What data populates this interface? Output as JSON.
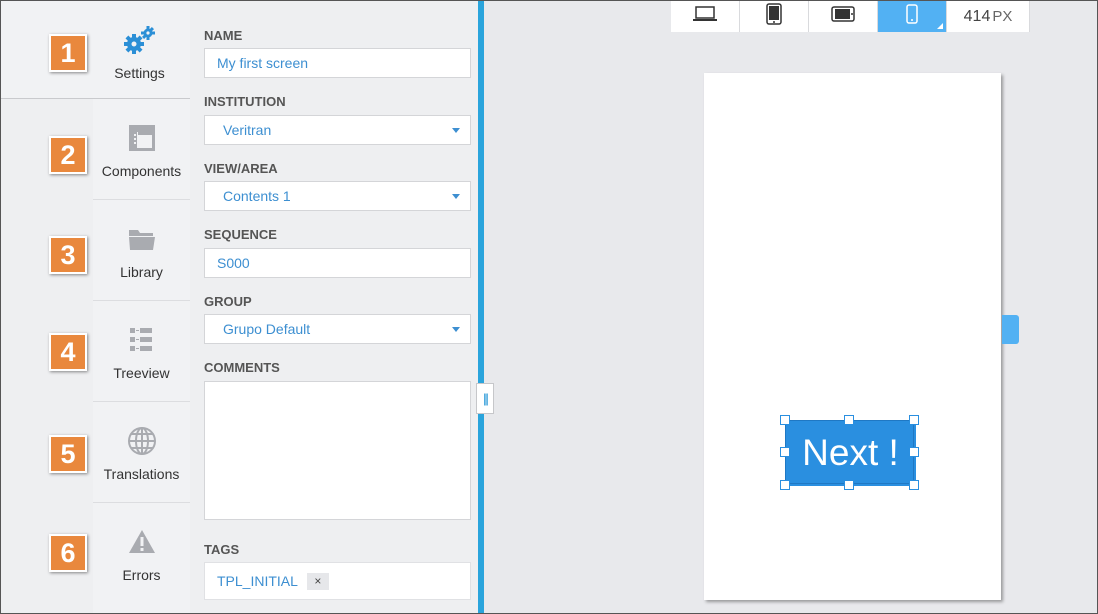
{
  "nav": {
    "items": [
      {
        "number": "1",
        "label": "Settings",
        "icon": "gears-icon"
      },
      {
        "number": "2",
        "label": "Components",
        "icon": "components-icon"
      },
      {
        "number": "3",
        "label": "Library",
        "icon": "folder-icon"
      },
      {
        "number": "4",
        "label": "Treeview",
        "icon": "tree-icon"
      },
      {
        "number": "5",
        "label": "Translations",
        "icon": "globe-icon"
      },
      {
        "number": "6",
        "label": "Errors",
        "icon": "warning-icon"
      }
    ]
  },
  "form": {
    "name_label": "NAME",
    "name_value": "My first screen",
    "institution_label": "INSTITUTION",
    "institution_value": "Veritran",
    "view_label": "VIEW/AREA",
    "view_value": "Contents 1",
    "sequence_label": "SEQUENCE",
    "sequence_value": "S000",
    "group_label": "GROUP",
    "group_value": "Grupo Default",
    "comments_label": "COMMENTS",
    "comments_value": "",
    "tags_label": "TAGS",
    "tags": [
      {
        "text": "TPL_INITIAL",
        "remove": "×"
      }
    ]
  },
  "divider": {
    "handle_glyph": "|||"
  },
  "toolbar": {
    "devices": [
      "laptop-icon",
      "tablet-icon",
      "tablet-landscape-icon",
      "phone-icon"
    ],
    "active_device": "phone-icon",
    "width_value": "414",
    "width_unit": "PX"
  },
  "canvas": {
    "button_text": "Next !"
  },
  "colors": {
    "accent": "#2aa4dc",
    "badge": "#e9883d",
    "active_device": "#52b1f3",
    "button": "#2a8fe0",
    "field_text": "#3d8fd1"
  }
}
